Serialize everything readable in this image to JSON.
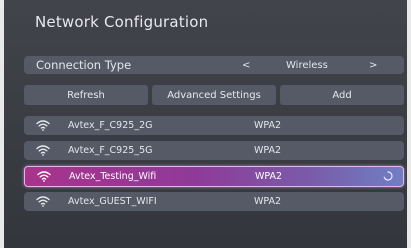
{
  "title": "Network Configuration",
  "connection": {
    "label": "Connection Type",
    "prev_glyph": "<",
    "value": "Wireless",
    "next_glyph": ">"
  },
  "buttons": {
    "refresh": "Refresh",
    "advanced": "Advanced Settings",
    "add": "Add"
  },
  "networks": [
    {
      "ssid": "Avtex_F_C925_2G",
      "security": "WPA2",
      "icon": "wifi-icon"
    },
    {
      "ssid": "Avtex_F_C925_5G",
      "security": "WPA2",
      "icon": "wifi-icon"
    },
    {
      "ssid": "Avtex_Testing_Wifi",
      "security": "WPA2",
      "icon": "wifi-icon",
      "selected": true,
      "connecting": true
    },
    {
      "ssid": "Avtex_GUEST_WIFI",
      "security": "WPA2",
      "icon": "wifi-icon"
    }
  ],
  "colors": {
    "background": "#3d3f46",
    "row": "#565a67",
    "selected_start": "#a9338a",
    "selected_end": "#6f7fc4"
  }
}
